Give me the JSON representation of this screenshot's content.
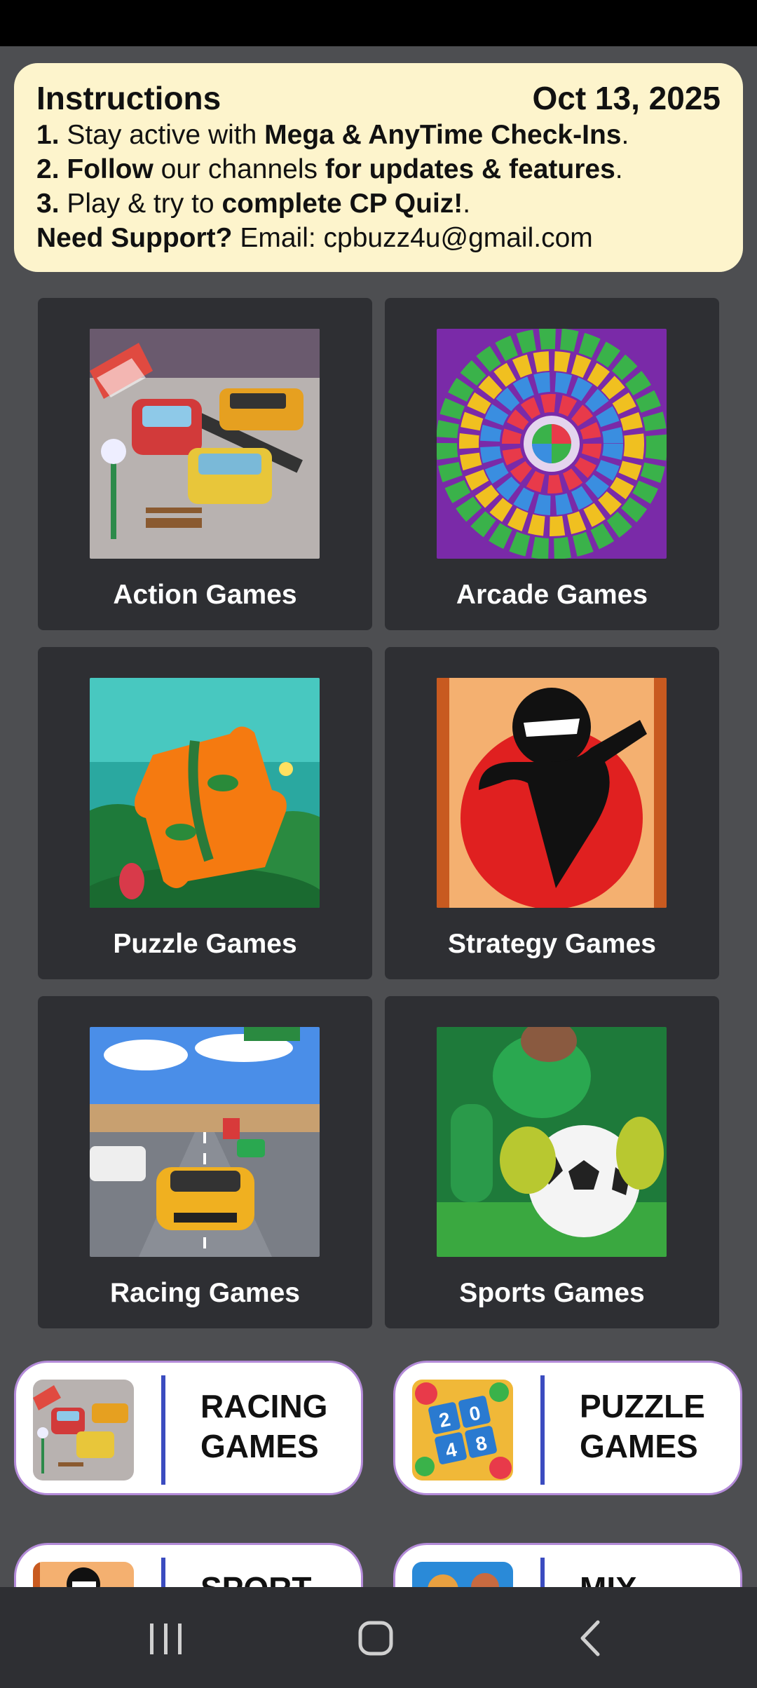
{
  "instructions": {
    "title": "Instructions",
    "date": "Oct 13, 2025",
    "line1": {
      "num": "1.",
      "a": " Stay active with ",
      "b": "Mega & AnyTime Check-Ins",
      "c": "."
    },
    "line2": {
      "num": "2.",
      "b1": " Follow",
      "a": " our channels ",
      "b2": "for updates & features",
      "c": "."
    },
    "line3": {
      "num": "3.",
      "a": " Play & try to ",
      "b": "complete CP Quiz!",
      "c": "."
    },
    "support": {
      "label": "Need Support?",
      "text": " Email: cpbuzz4u@gmail.com"
    }
  },
  "categories": [
    {
      "label": "Action Games",
      "icon": "parking-cars-thumbnail"
    },
    {
      "label": "Arcade Games",
      "icon": "bubble-shooter-thumbnail"
    },
    {
      "label": "Puzzle Games",
      "icon": "jungle-jigsaw-thumbnail"
    },
    {
      "label": "Strategy Games",
      "icon": "ninja-thumbnail"
    },
    {
      "label": "Racing Games",
      "icon": "highway-racer-thumbnail"
    },
    {
      "label": "Sports Games",
      "icon": "goalkeeper-thumbnail"
    }
  ],
  "quick_links": [
    {
      "line1": "RACING",
      "line2": "GAMES"
    },
    {
      "line1": "PUZZLE",
      "line2": "GAMES"
    },
    {
      "line1": "SPORT",
      "line2": ""
    },
    {
      "line1": "MIX",
      "line2": ""
    }
  ],
  "puzzle_tile_numbers": [
    "2",
    "0",
    "4",
    "8"
  ],
  "colors": {
    "card_bg": "#2e2f33",
    "page_bg": "#4d4e51",
    "instructions_bg": "#fdf4cc",
    "pill_border": "#b38ad8",
    "divider": "#3b4cc0"
  },
  "nav": {
    "recents": "recents-icon",
    "home": "home-icon",
    "back": "back-icon"
  }
}
